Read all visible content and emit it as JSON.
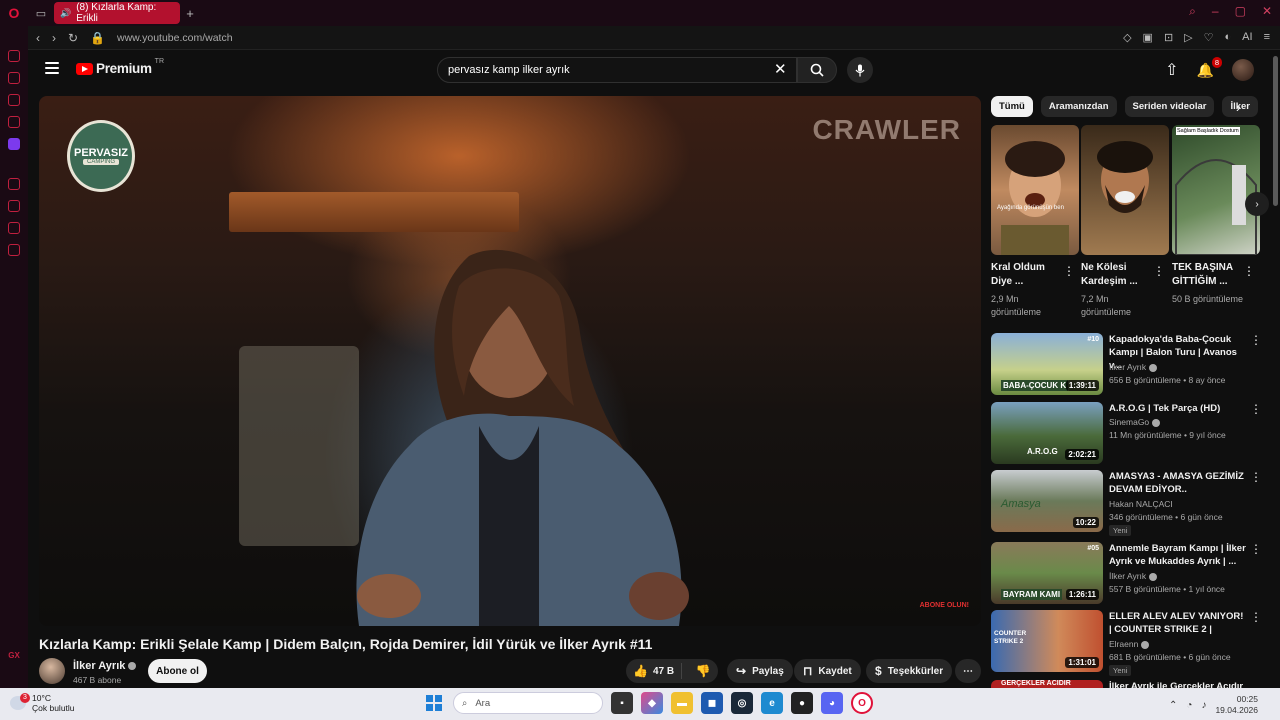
{
  "browser": {
    "tab_title": "(8) Kızlarla Kamp: Erikli",
    "url": "www.youtube.com/watch",
    "ai_label": "AI",
    "gx_label": "GX"
  },
  "yt": {
    "logo_text": "Premium",
    "logo_tr": "TR",
    "search_value": "pervasız kamp ilker ayrık",
    "notif_count": "8"
  },
  "video": {
    "title": "Kızlarla Kamp: Erikli Şelale Kamp | Didem Balçın, Rojda Demirer, İdil Yürük ve İlker Ayrık #11",
    "wm_word": "PERVASIZ",
    "wm_sub": "CAMPING",
    "bg_brand": "CRAWLER",
    "abone_wm": "ABONE OLUN!",
    "channel": "İlker Ayrık",
    "subs": "467 B abone",
    "subscribe_label": "Abone ol",
    "likes": "47 B",
    "share_label": "Paylaş",
    "save_label": "Kaydet",
    "thanks_label": "Teşekkürler"
  },
  "chips": [
    "Tümü",
    "Aramanızdan",
    "Seriden videolar",
    "İlker"
  ],
  "shorts": [
    {
      "title": "Kral Oldum Diye ...",
      "views": "2,9 Mn görüntüleme",
      "caption": "Ayağında görünüşün ben"
    },
    {
      "title": "Ne Kölesi Kardeşim ...",
      "views": "7,2 Mn görüntüleme",
      "caption": ""
    },
    {
      "title": "TEK BAŞINA GİTTİĞİM ...",
      "views": "50 B görüntüleme",
      "caption": "Sağlam Başladık Dostum"
    }
  ],
  "recs": [
    {
      "title": "Kapadokya'da Baba-Çocuk Kampı | Balon Turu | Avanos v...",
      "channel": "İlker Ayrık",
      "meta": "656 B görüntüleme • 8 ay önce",
      "duration": "1:39:11",
      "new": "",
      "thumb_text": "BABA-ÇOCUK K",
      "badge": "#10"
    },
    {
      "title": "A.R.O.G | Tek Parça (HD)",
      "channel": "SinemaGo",
      "meta": "11 Mn görüntüleme • 9 yıl önce",
      "duration": "2:02:21",
      "new": "",
      "thumb_text": "A.R.O.G",
      "badge": ""
    },
    {
      "title": "AMASYA3 - AMASYA GEZİMİZ DEVAM EDİYOR..",
      "channel": "Hakan NALÇACI",
      "meta": "346 görüntüleme • 6 gün önce",
      "duration": "10:22",
      "new": "Yeni",
      "thumb_text": "Amasya",
      "badge": ""
    },
    {
      "title": "Annemle Bayram Kampı | İlker Ayrık ve Mukaddes Ayrık | ...",
      "channel": "İlker Ayrık",
      "meta": "557 B görüntüleme • 1 yıl önce",
      "duration": "1:26:11",
      "new": "",
      "thumb_text": "BAYRAM KAMI",
      "badge": "#05"
    },
    {
      "title": "ELLER ALEV ALEV YANIYOR! | COUNTER STRIKE 2 |",
      "channel": "Elraenn",
      "meta": "681 B görüntüleme • 6 gün önce",
      "duration": "1:31:01",
      "new": "Yeni",
      "thumb_text": "COUNTER STRIKE 2",
      "badge": ""
    },
    {
      "title": "İlker Ayrık ile Gerçekler Acıdır |",
      "channel": "",
      "meta": "",
      "duration": "",
      "new": "",
      "thumb_text": "GERÇEKLER ACIDIR",
      "badge": ""
    }
  ],
  "taskbar": {
    "weather_temp": "10°C",
    "weather_desc": "Çok bulutlu",
    "weather_badge": "3",
    "search_label": "Ara",
    "time": "00:25",
    "date": "19.04.2026"
  },
  "colors": {
    "accent": "#ff0000",
    "opera": "#e0123a",
    "tab_active": "#b3112e"
  }
}
